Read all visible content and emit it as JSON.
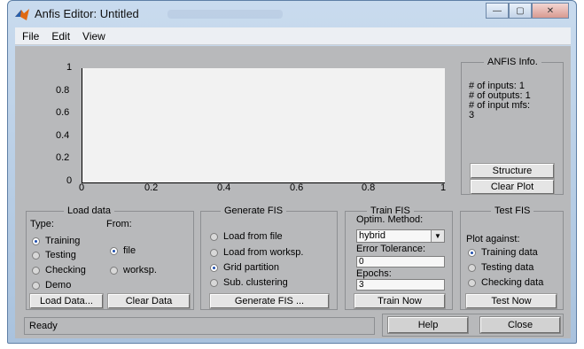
{
  "window": {
    "title": "Anfis Editor: Untitled",
    "minimize_glyph": "—",
    "maximize_glyph": "▢",
    "close_glyph": "✕"
  },
  "menu": {
    "file": "File",
    "edit": "Edit",
    "view": "View"
  },
  "plot": {
    "y_ticks": [
      "1",
      "0.8",
      "0.6",
      "0.4",
      "0.2",
      "0"
    ],
    "x_ticks": [
      "0",
      "0.2",
      "0.4",
      "0.6",
      "0.8",
      "1"
    ]
  },
  "anfis_info": {
    "title": "ANFIS Info.",
    "inputs": "# of inputs: 1",
    "outputs": "# of outputs: 1",
    "input_mfs": "# of input mfs:",
    "input_mfs_value": "3",
    "structure_button": "Structure",
    "clear_plot_button": "Clear Plot"
  },
  "load_data": {
    "title": "Load data",
    "type_label": "Type:",
    "from_label": "From:",
    "type_options": [
      "Training",
      "Testing",
      "Checking",
      "Demo"
    ],
    "from_options": [
      "file",
      "worksp."
    ],
    "load_button": "Load Data...",
    "clear_button": "Clear Data"
  },
  "generate_fis": {
    "title": "Generate FIS",
    "options": [
      "Load from file",
      "Load from worksp.",
      "Grid partition",
      "Sub. clustering"
    ],
    "button": "Generate FIS ..."
  },
  "train_fis": {
    "title": "Train FIS",
    "optim_label": "Optim. Method:",
    "optim_value": "hybrid",
    "error_label": "Error Tolerance:",
    "error_value": "0",
    "epochs_label": "Epochs:",
    "epochs_value": "3",
    "button": "Train Now"
  },
  "test_fis": {
    "title": "Test FIS",
    "plot_against": "Plot against:",
    "options": [
      "Training data",
      "Testing data",
      "Checking data"
    ],
    "button": "Test Now"
  },
  "status": {
    "text": "Ready"
  },
  "footer": {
    "help": "Help",
    "close": "Close"
  }
}
